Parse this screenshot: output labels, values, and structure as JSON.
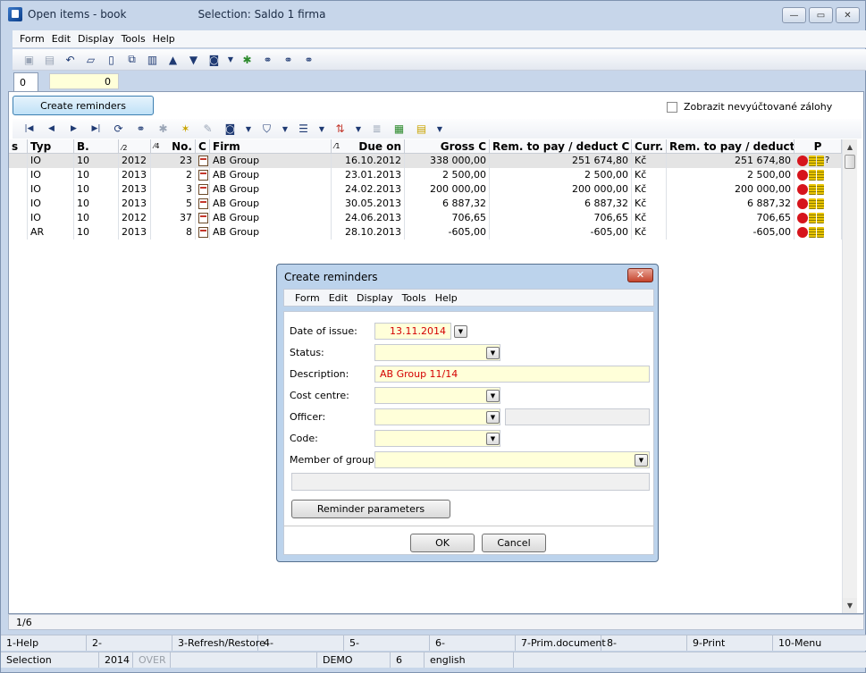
{
  "window": {
    "title": "Open items - book",
    "selection": "Selection: Saldo 1 firma",
    "buttons": {
      "minimize": "—",
      "maximize": "▭",
      "close": "✕"
    }
  },
  "menu": [
    "Form",
    "Edit",
    "Display",
    "Tools",
    "Help"
  ],
  "toolbar_icons": [
    "save-icon",
    "save-as-icon",
    "undo-icon",
    "open-folder-icon",
    "new-page-icon",
    "copy-icon",
    "book-icon",
    "arrow-up-icon",
    "arrow-down-icon",
    "camera-icon",
    "dropdown-arrow-icon",
    "tree-icon",
    "binoculars-icon",
    "find-next-icon",
    "find-all-icon"
  ],
  "tab": {
    "label": "0",
    "value": "0"
  },
  "main": {
    "create_reminders_label": "Create reminders",
    "checkbox_label": "Zobrazit nevyúčtované zálohy"
  },
  "grid": {
    "columns": [
      "s",
      "Typ",
      "B.",
      "Ob.",
      "No.",
      "C",
      "Firm",
      "Due on",
      "Gross C",
      "Rem. to pay / deduct C",
      "Curr.",
      "Rem. to pay / deduct",
      "P"
    ],
    "sort_markers": {
      "ob": "2",
      "no": "4",
      "due": "1"
    },
    "rows": [
      {
        "typ": "IO",
        "b": "10",
        "ob": "2012",
        "no": "23",
        "firm": "AB Group",
        "due": "16.10.2012",
        "gross": "338 000,00",
        "rem_c": "251 674,80",
        "curr": "Kč",
        "rem": "251 674,80",
        "p_suffix": "?"
      },
      {
        "typ": "IO",
        "b": "10",
        "ob": "2013",
        "no": "2",
        "firm": "AB Group",
        "due": "23.01.2013",
        "gross": "2 500,00",
        "rem_c": "2 500,00",
        "curr": "Kč",
        "rem": "2 500,00",
        "p_suffix": ""
      },
      {
        "typ": "IO",
        "b": "10",
        "ob": "2013",
        "no": "3",
        "firm": "AB Group",
        "due": "24.02.2013",
        "gross": "200 000,00",
        "rem_c": "200 000,00",
        "curr": "Kč",
        "rem": "200 000,00",
        "p_suffix": ""
      },
      {
        "typ": "IO",
        "b": "10",
        "ob": "2013",
        "no": "5",
        "firm": "AB Group",
        "due": "30.05.2013",
        "gross": "6 887,32",
        "rem_c": "6 887,32",
        "curr": "Kč",
        "rem": "6 887,32",
        "p_suffix": ""
      },
      {
        "typ": "IO",
        "b": "10",
        "ob": "2012",
        "no": "37",
        "firm": "AB Group",
        "due": "24.06.2013",
        "gross": "706,65",
        "rem_c": "706,65",
        "curr": "Kč",
        "rem": "706,65",
        "p_suffix": ""
      },
      {
        "typ": "AR",
        "b": "10",
        "ob": "2013",
        "no": "8",
        "firm": "AB Group",
        "due": "28.10.2013",
        "gross": "-605,00",
        "rem_c": "-605,00",
        "curr": "Kč",
        "rem": "-605,00",
        "p_suffix": ""
      }
    ]
  },
  "record_count": "1/6",
  "fkeys": [
    "1-Help",
    "2-",
    "3-Refresh/Restore",
    "4-",
    "5-",
    "6-",
    "7-Prim.document",
    "8-",
    "9-Print",
    "10-Menu"
  ],
  "status": {
    "mode": "Selection",
    "year": "2014",
    "over": "OVER",
    "db": "DEMO",
    "num": "6",
    "lang": "english"
  },
  "dialog": {
    "title": "Create reminders",
    "close": "✕",
    "menu": [
      "Form",
      "Edit",
      "Display",
      "Tools",
      "Help"
    ],
    "labels": {
      "date": "Date of issue:",
      "status": "Status:",
      "description": "Description:",
      "cost_centre": "Cost centre:",
      "officer": "Officer:",
      "code": "Code:",
      "member": "Member of group:"
    },
    "values": {
      "date": "13.11.2014",
      "description": "AB Group 11/14"
    },
    "reminder_params_label": "Reminder parameters",
    "ok_label": "OK",
    "cancel_label": "Cancel"
  },
  "colors": {
    "accent": "#3c7fb1",
    "field_bg": "#ffffd9",
    "value_red": "#d40000",
    "status_red": "#d6141c"
  }
}
